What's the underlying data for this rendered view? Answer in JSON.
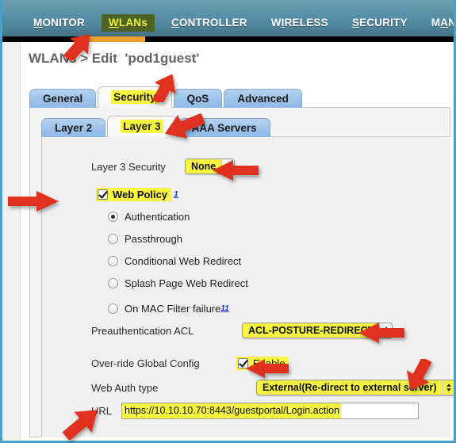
{
  "nav": {
    "items": [
      {
        "label": "MONITOR",
        "accesskey": "M",
        "active": false
      },
      {
        "label": "WLANs",
        "accesskey": "W",
        "active": true
      },
      {
        "label": "CONTROLLER",
        "accesskey": "C",
        "active": false
      },
      {
        "label": "WIRELESS",
        "accesskey": "I",
        "active": false
      },
      {
        "label": "SECURITY",
        "accesskey": "S",
        "active": false
      },
      {
        "label": "MANAGEMENT",
        "accesskey": "A",
        "active": false
      }
    ],
    "active_color": "#4d6326",
    "active_text_color": "#ecec3a",
    "underline_color": "#f0a030"
  },
  "page": {
    "title": "WLANs > Edit  'pod1guest'"
  },
  "tabs_outer": [
    {
      "label": "General",
      "active": false
    },
    {
      "label": "Security",
      "active": true
    },
    {
      "label": "QoS",
      "active": false
    },
    {
      "label": "Advanced",
      "active": false
    }
  ],
  "tabs_inner": [
    {
      "label": "Layer 2",
      "active": false
    },
    {
      "label": "Layer 3",
      "active": true
    },
    {
      "label": "AAA Servers",
      "active": false
    }
  ],
  "form": {
    "layer3_security": {
      "label": "Layer 3 Security",
      "value": "None"
    },
    "web_policy": {
      "label": "Web Policy",
      "footnote": "1",
      "checked": true
    },
    "web_policy_options": [
      {
        "label": "Authentication",
        "selected": true,
        "footnote": ""
      },
      {
        "label": "Passthrough",
        "selected": false,
        "footnote": ""
      },
      {
        "label": "Conditional Web Redirect",
        "selected": false,
        "footnote": ""
      },
      {
        "label": "Splash Page Web Redirect",
        "selected": false,
        "footnote": ""
      },
      {
        "label": "On MAC Filter failure",
        "selected": false,
        "footnote": "11"
      }
    ],
    "preauth_acl": {
      "label": "Preauthentication ACL",
      "value": "ACL-POSTURE-REDIRECT"
    },
    "override_global": {
      "label": "Over-ride Global Config",
      "checkbox_label": "Enable",
      "checked": true
    },
    "web_auth_type": {
      "label": "Web Auth type",
      "value": "External(Re-direct to external server)"
    },
    "url": {
      "label": "URL",
      "value": "https://10.10.10.70:8443/guestportal/Login.action"
    }
  },
  "annotations": {
    "arrow_color": "#e0301e",
    "count": 8
  }
}
